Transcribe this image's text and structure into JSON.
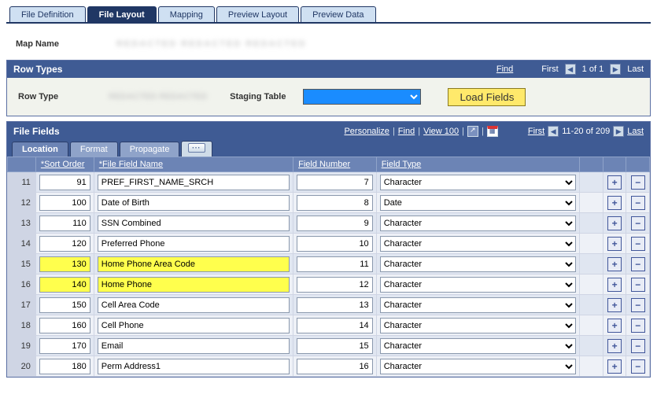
{
  "page_tabs": [
    {
      "id": "file-def",
      "label": "File Definition",
      "active": false
    },
    {
      "id": "file-layout",
      "label": "File Layout",
      "active": true
    },
    {
      "id": "mapping",
      "label": "Mapping",
      "active": false
    },
    {
      "id": "preview-layout",
      "label": "Preview Layout",
      "active": false
    },
    {
      "id": "preview-data",
      "label": "Preview Data",
      "active": false
    }
  ],
  "map_name_label": "Map Name",
  "map_name_value": "REDACTED REDACTED REDACTED",
  "row_types": {
    "title": "Row Types",
    "find_label": "Find",
    "nav_first": "First",
    "nav_counter": "1 of 1",
    "nav_last": "Last",
    "row_type_label": "Row Type",
    "row_type_value": "REDACTED REDACTED",
    "staging_table_label": "Staging Table",
    "staging_selected": "",
    "load_button": "Load Fields"
  },
  "file_fields": {
    "title": "File Fields",
    "personalize": "Personalize",
    "find": "Find",
    "view100": "View 100",
    "nav_first": "First",
    "nav_range": "11-20 of 209",
    "nav_last": "Last",
    "subtabs": [
      {
        "id": "location",
        "label": "Location",
        "active": true
      },
      {
        "id": "format",
        "label": "Format",
        "active": false
      },
      {
        "id": "propagate",
        "label": "Propagate",
        "active": false
      }
    ],
    "columns": {
      "sort_order": "*Sort Order",
      "file_field_name": "*File Field Name",
      "field_number": "Field Number",
      "field_type": "Field Type"
    },
    "rows": [
      {
        "idx": 11,
        "sort_order": "91",
        "name": "PREF_FIRST_NAME_SRCH",
        "number": "7",
        "type": "Character",
        "hl": false
      },
      {
        "idx": 12,
        "sort_order": "100",
        "name": "Date of Birth",
        "number": "8",
        "type": "Date",
        "hl": false
      },
      {
        "idx": 13,
        "sort_order": "110",
        "name": "SSN Combined",
        "number": "9",
        "type": "Character",
        "hl": false
      },
      {
        "idx": 14,
        "sort_order": "120",
        "name": "Preferred Phone",
        "number": "10",
        "type": "Character",
        "hl": false
      },
      {
        "idx": 15,
        "sort_order": "130",
        "name": "Home Phone Area Code",
        "number": "11",
        "type": "Character",
        "hl": true
      },
      {
        "idx": 16,
        "sort_order": "140",
        "name": "Home Phone",
        "number": "12",
        "type": "Character",
        "hl": true
      },
      {
        "idx": 17,
        "sort_order": "150",
        "name": "Cell Area Code",
        "number": "13",
        "type": "Character",
        "hl": false
      },
      {
        "idx": 18,
        "sort_order": "160",
        "name": "Cell Phone",
        "number": "14",
        "type": "Character",
        "hl": false
      },
      {
        "idx": 19,
        "sort_order": "170",
        "name": "Email",
        "number": "15",
        "type": "Character",
        "hl": false
      },
      {
        "idx": 20,
        "sort_order": "180",
        "name": "Perm Address1",
        "number": "16",
        "type": "Character",
        "hl": false
      }
    ]
  },
  "glyphs": {
    "plus": "+",
    "minus": "−",
    "left": "◀",
    "right": "▶"
  }
}
